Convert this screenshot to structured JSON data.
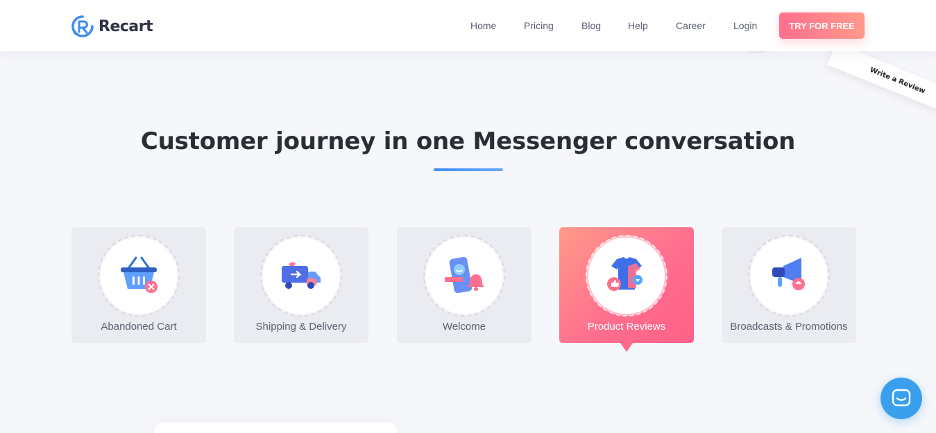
{
  "brand": {
    "name": "Recart",
    "accent": "#3f8cf3",
    "cta_color": "#ff6f8e"
  },
  "nav": {
    "items": [
      "Home",
      "Pricing",
      "Blog",
      "Help",
      "Career",
      "Login"
    ],
    "cta_label": "TRY FOR FREE"
  },
  "ribbon": {
    "label": "Write a Review"
  },
  "section": {
    "title": "Customer journey in one Messenger conversation",
    "cards": [
      {
        "label": "Abandoned Cart",
        "icon": "basket-icon",
        "active": false
      },
      {
        "label": "Shipping & Delivery",
        "icon": "truck-icon",
        "active": false
      },
      {
        "label": "Welcome",
        "icon": "phone-bell-icon",
        "active": false
      },
      {
        "label": "Product Reviews",
        "icon": "tshirt-thumbs-icon",
        "active": true
      },
      {
        "label": "Broadcasts & Promotions",
        "icon": "megaphone-icon",
        "active": false
      }
    ]
  },
  "chat": {
    "icon": "chat-icon"
  }
}
